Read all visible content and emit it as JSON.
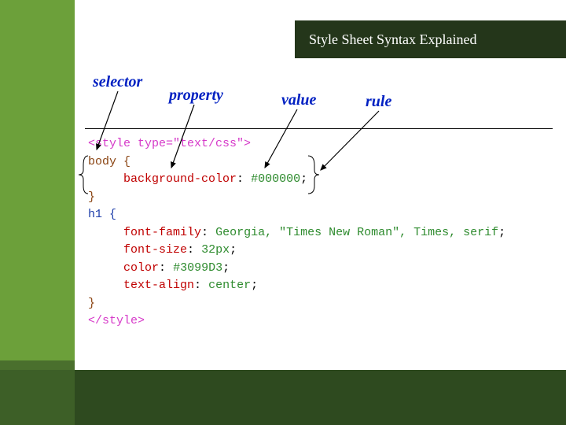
{
  "title": "Style Sheet Syntax Explained",
  "labels": {
    "selector": "selector",
    "property": "property",
    "value": "value",
    "rule": "rule"
  },
  "code": {
    "open_tag": "<style type=\"text/css\">",
    "body_sel": "body {",
    "body_decl_prop": "background-color",
    "body_decl_val": "#000000",
    "close_brace": "}",
    "h1_sel": "h1 {",
    "h1_ff_prop": "font-family",
    "h1_ff_val": "Georgia, \"Times New Roman\", Times, serif",
    "h1_fs_prop": "font-size",
    "h1_fs_val": "32px",
    "h1_color_prop": "color",
    "h1_color_val": "#3099D3",
    "h1_ta_prop": "text-align",
    "h1_ta_val": "center",
    "close_tag": "</style>"
  }
}
